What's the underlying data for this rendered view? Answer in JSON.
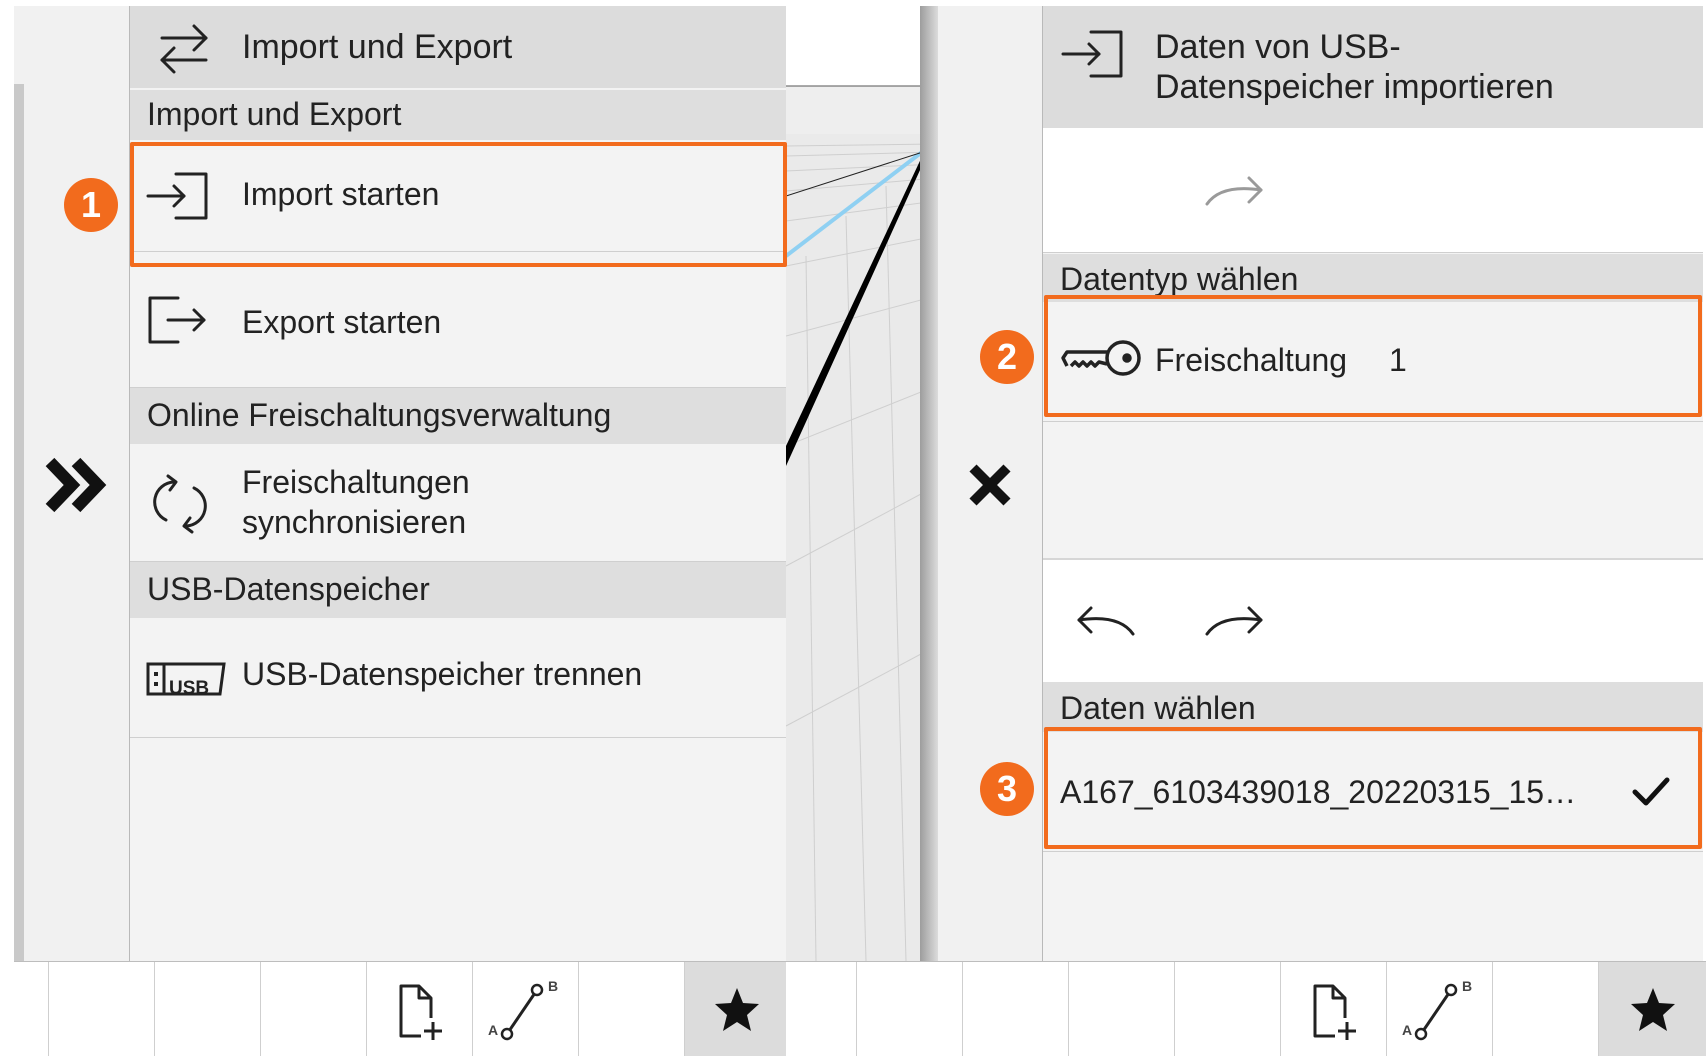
{
  "left": {
    "header": {
      "title": "Import und Export",
      "icon": "swap-arrows-icon"
    },
    "sections": [
      {
        "title": "Import und Export"
      },
      {
        "title": "Online Freischaltungsverwaltung"
      },
      {
        "title": "USB-Datenspeicher"
      }
    ],
    "items": {
      "import": {
        "label": "Import starten",
        "icon": "import-icon"
      },
      "export": {
        "label": "Export starten",
        "icon": "export-icon"
      },
      "sync_line1": "Freischaltungen",
      "sync_line2": "synchronisieren",
      "usb": {
        "label": "USB-Datenspeicher trennen",
        "icon_text": "USB"
      }
    },
    "badge": "1",
    "expand_icon": "double-chevron-right-icon"
  },
  "right": {
    "header": {
      "title_line1": "Daten von USB-",
      "title_line2": "Datenspeicher importieren",
      "icon": "import-icon"
    },
    "datatype": {
      "section_title": "Datentyp wählen",
      "item_label": "Freischaltung",
      "item_count": "1",
      "icon": "key-icon"
    },
    "data": {
      "section_title": "Daten wählen",
      "file_name": "A167_6103439018_20220315_15…",
      "check_icon": "checkmark-icon"
    },
    "badges": [
      "2",
      "3"
    ],
    "close_icon": "close-icon"
  },
  "toolbar": {
    "icons": [
      "new-document-icon",
      "ab-line-icon",
      "star-icon"
    ],
    "ab_letters": {
      "a": "A",
      "b": "B"
    }
  },
  "colors": {
    "accent": "#f26b1d",
    "panel_bg": "#f3f3f3",
    "header_bg": "#dcdcdc"
  }
}
